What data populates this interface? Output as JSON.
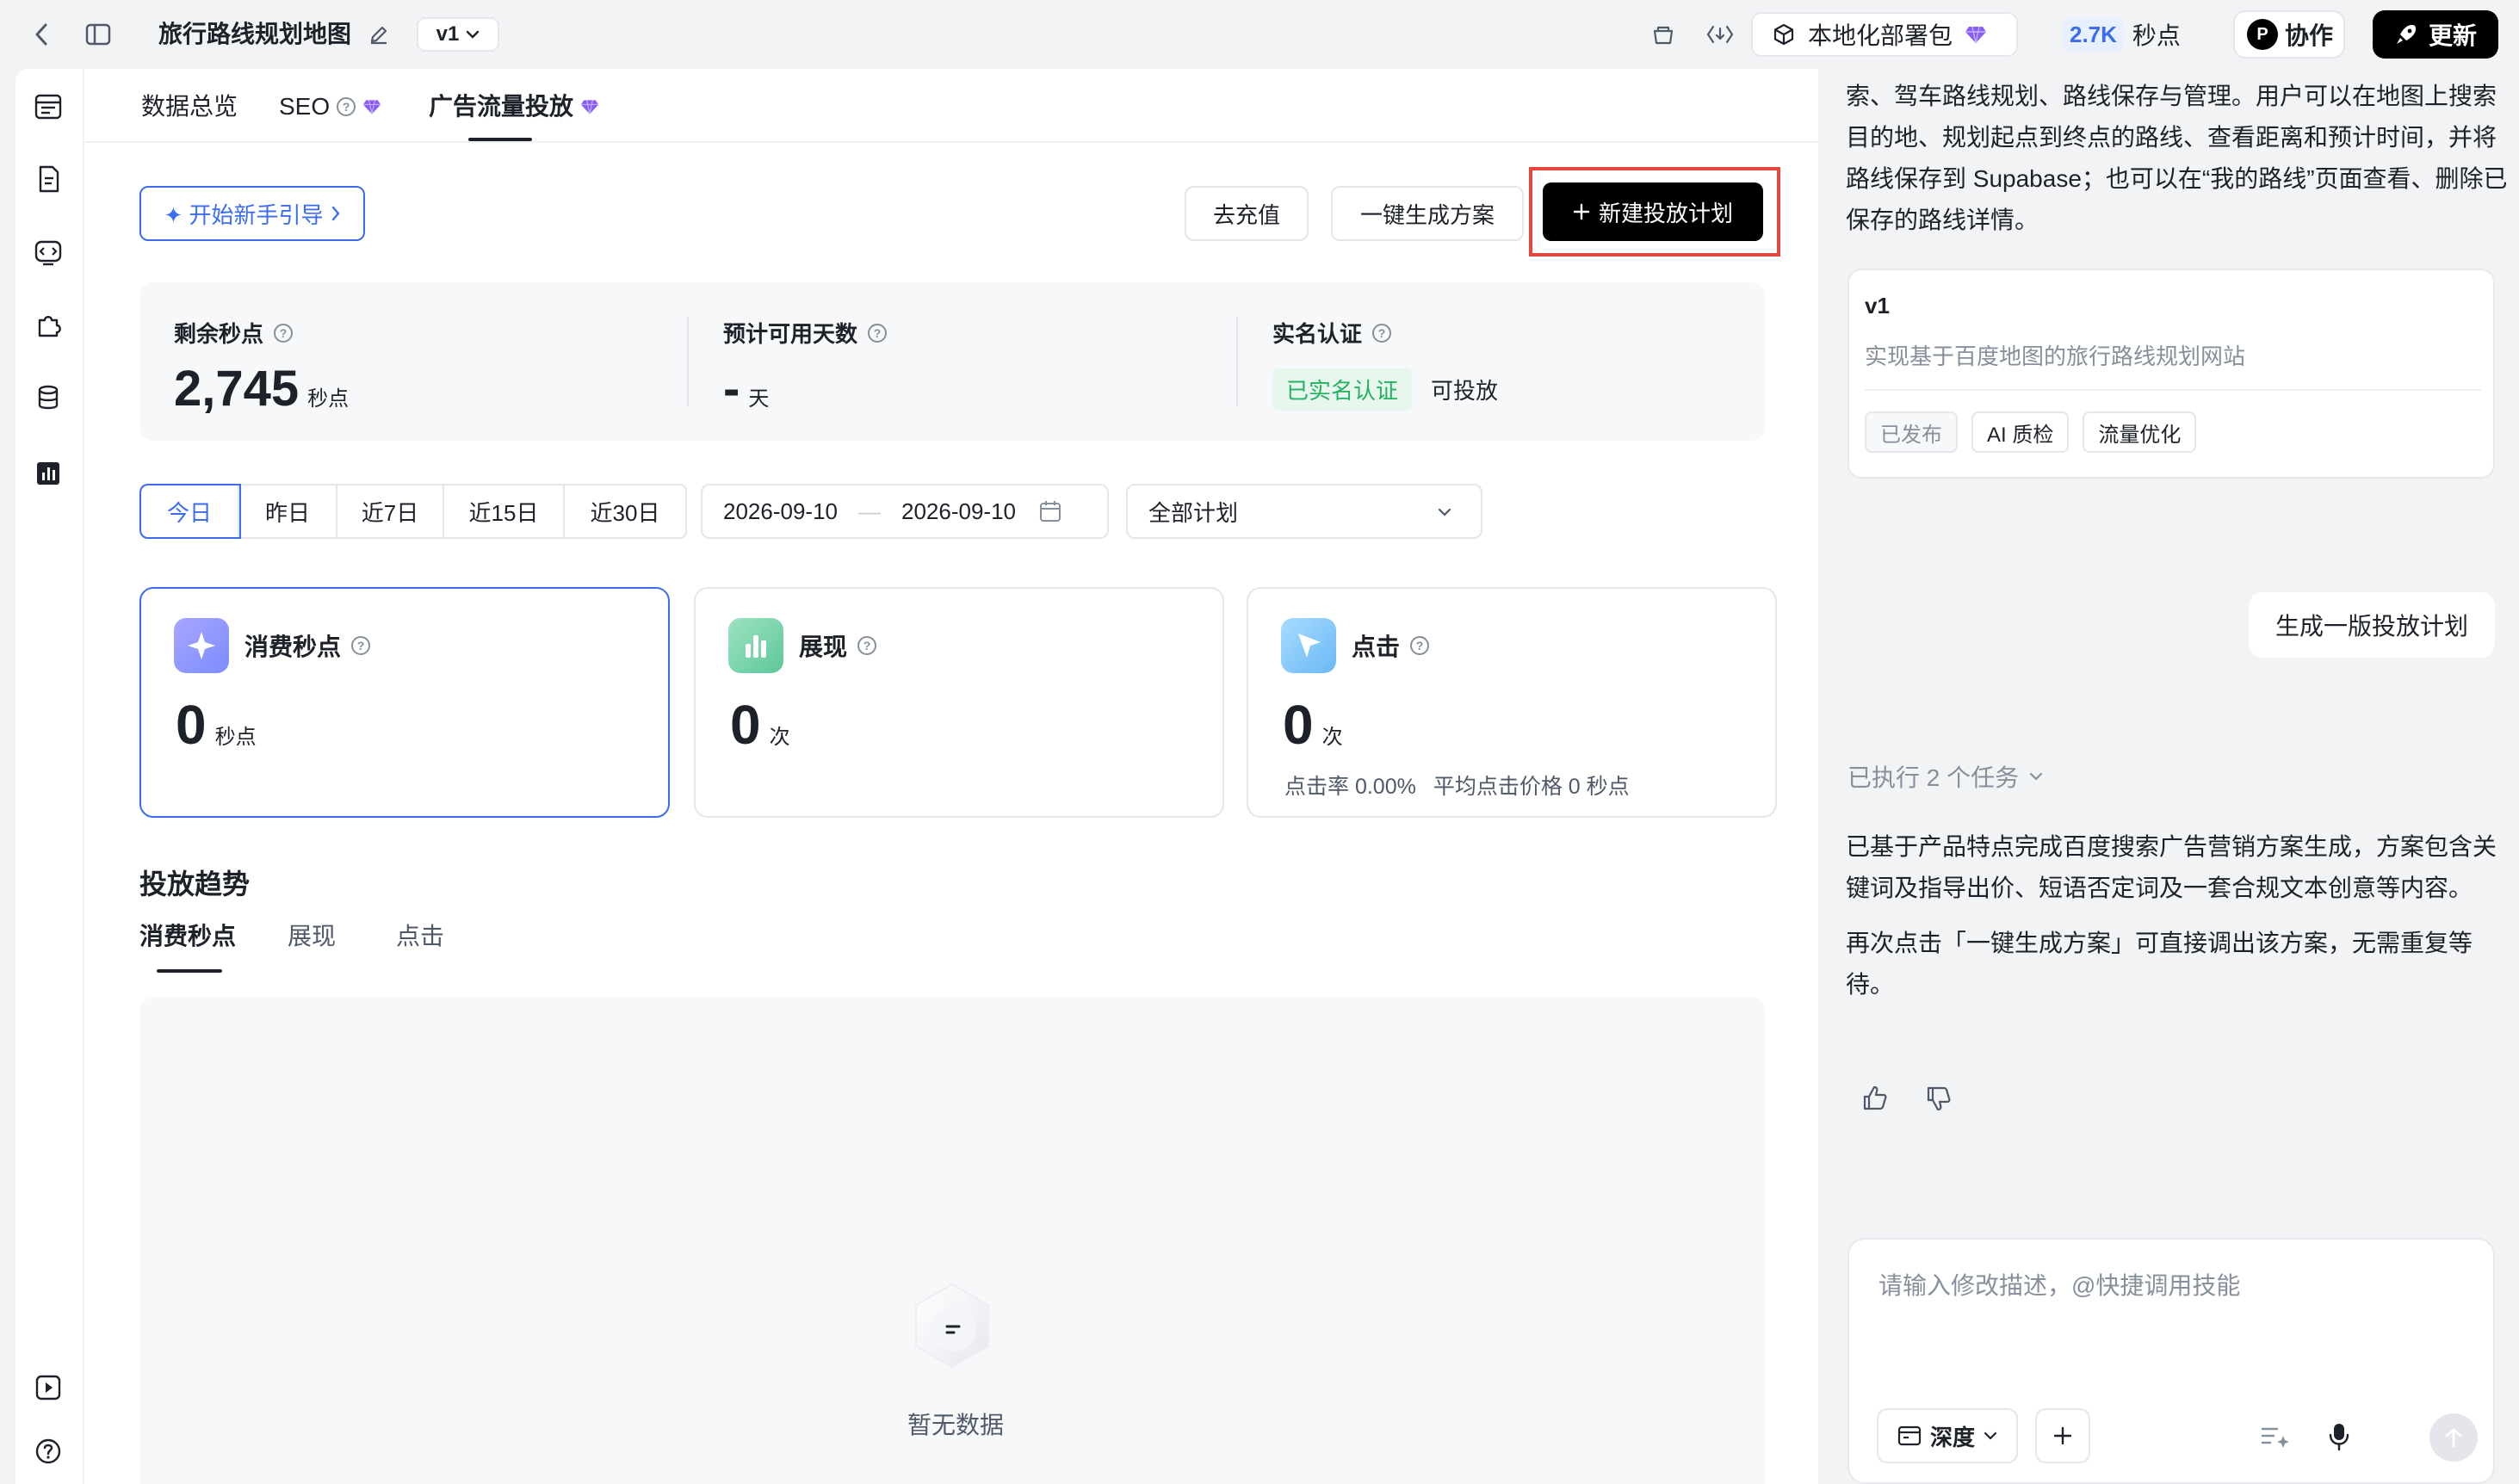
{
  "topbar": {
    "title": "旅行路线规划地图",
    "version": "v1",
    "deploy_label": "本地化部署包",
    "credits_value": "2.7K",
    "credits_unit": "秒点",
    "collab_avatar": "P",
    "collab_label": "协作",
    "update_label": "更新"
  },
  "tabs": [
    {
      "label": "数据总览"
    },
    {
      "label": "SEO"
    },
    {
      "label": "广告流量投放"
    }
  ],
  "actions": {
    "guide": "✦ 开始新手引导",
    "recharge": "去充值",
    "generate": "一键生成方案",
    "new_plan": "新建投放计划"
  },
  "stats": {
    "remaining": {
      "label": "剩余秒点",
      "value": "2,745",
      "unit": "秒点"
    },
    "days": {
      "label": "预计可用天数",
      "value": "-",
      "unit": "天"
    },
    "verify": {
      "label": "实名认证",
      "tag": "已实名认证",
      "status": "可投放"
    }
  },
  "filters": {
    "ranges": [
      "今日",
      "昨日",
      "近7日",
      "近15日",
      "近30日"
    ],
    "active_range": "今日",
    "date_start": "2026-09-10",
    "date_sep": "—",
    "date_end": "2026-09-10",
    "plan_select": "全部计划"
  },
  "cards": {
    "spend": {
      "name": "消费秒点",
      "value": "0",
      "unit": "秒点"
    },
    "impressions": {
      "name": "展现",
      "value": "0",
      "unit": "次"
    },
    "clicks": {
      "name": "点击",
      "value": "0",
      "unit": "次",
      "ctr": "点击率 0.00%",
      "cpc": "平均点击价格 0 秒点"
    }
  },
  "trend": {
    "title": "投放趋势",
    "tabs": [
      "消费秒点",
      "展现",
      "点击"
    ],
    "empty": "暂无数据"
  },
  "chat": {
    "intro": "索、驾车路线规划、路线保存与管理。用户可以在地图上搜索目的地、规划起点到终点的路线、查看距离和预计时间，并将路线保存到 Supabase；也可以在“我的路线”页面查看、删除已保存的路线详情。",
    "version_card": {
      "title": "v1",
      "desc": "实现基于百度地图的旅行路线规划网站",
      "chips": [
        "已发布",
        "AI 质检",
        "流量优化"
      ]
    },
    "user_msg": "生成一版投放计划",
    "tasks": "已执行 2 个任务",
    "reply1": "已基于产品特点完成百度搜索广告营销方案生成，方案包含关键词及指导出价、短语否定词及一套合规文本创意等内容。",
    "reply2": "再次点击「一键生成方案」可直接调出该方案，无需重复等待。",
    "input_placeholder": "请输入修改描述，@快捷调用技能",
    "depth": "深度"
  }
}
